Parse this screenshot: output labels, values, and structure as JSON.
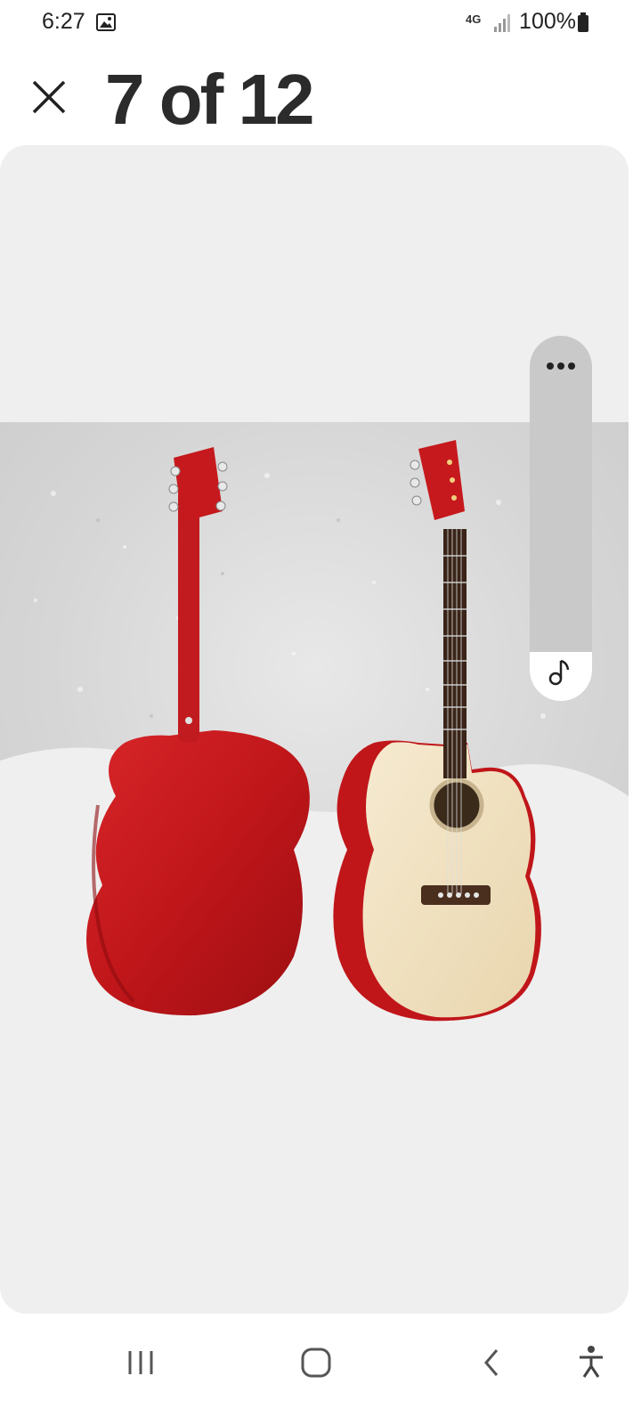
{
  "status_bar": {
    "time": "6:27",
    "network": "4G",
    "battery": "100%",
    "icons": [
      "image-notification-icon",
      "lte-icon",
      "signal-icon",
      "battery-icon"
    ]
  },
  "header": {
    "title": "7 of 12",
    "close_icon": "close-icon"
  },
  "viewer": {
    "image_description_alt": "Two acoustic cutaway guitars",
    "side_controls": [
      "more-options-icon",
      "music-note-icon"
    ]
  },
  "colors": {
    "title": "#2b2b2b",
    "viewer_bg": "#efefef",
    "pill_bg": "#c9c9c9",
    "guitar_red": "#c0161a",
    "guitar_natural": "#f1e3c4"
  },
  "nav_bar": {
    "icons": [
      "recent-apps-icon",
      "home-icon",
      "back-icon",
      "accessibility-icon"
    ]
  }
}
